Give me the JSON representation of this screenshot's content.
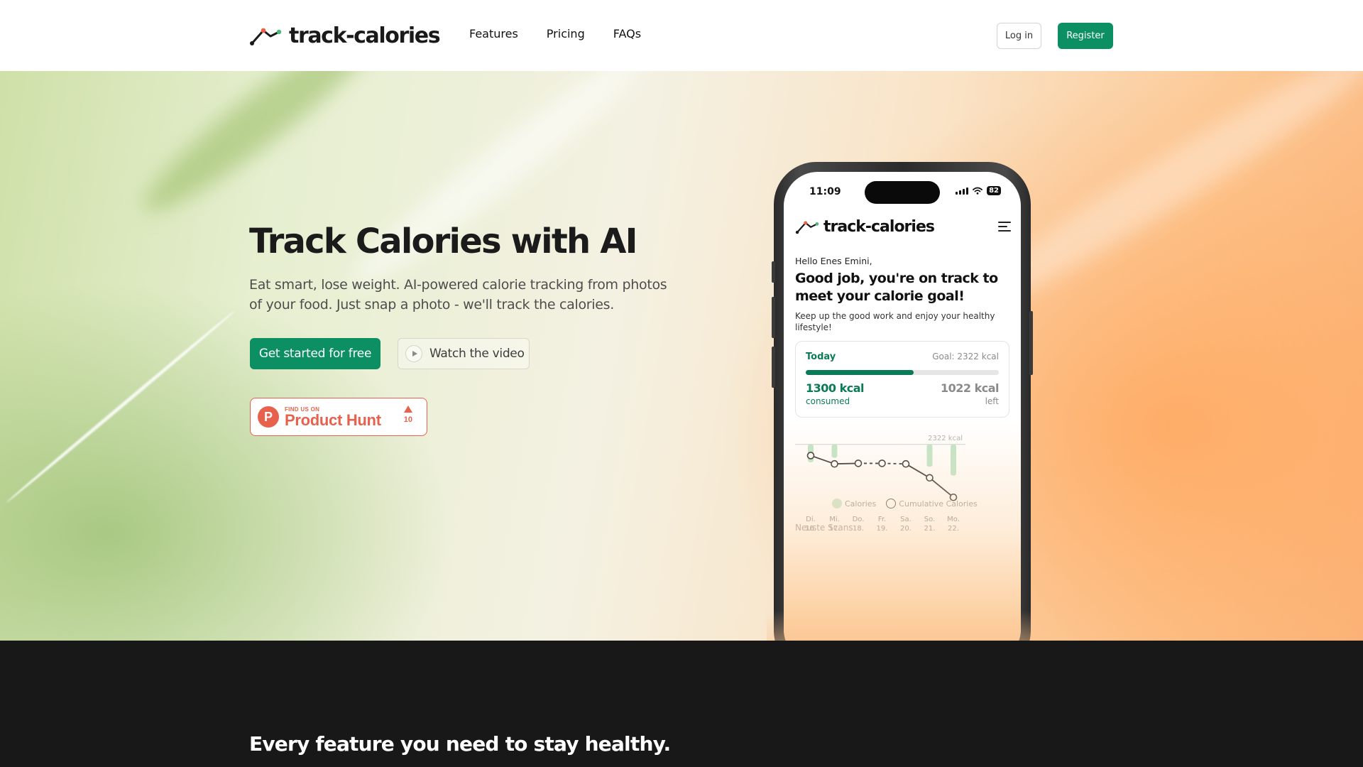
{
  "brand": {
    "name": "track-calories"
  },
  "nav": {
    "features": "Features",
    "pricing": "Pricing",
    "faqs": "FAQs"
  },
  "auth": {
    "login": "Log in",
    "register": "Register"
  },
  "hero": {
    "title": "Track Calories with AI",
    "subtitle": "Eat smart, lose weight. AI-powered calorie tracking from photos of your food. Just snap a photo - we'll track the calories.",
    "cta_primary": "Get started for free",
    "cta_video": "Watch the video"
  },
  "product_hunt": {
    "small": "FIND US ON",
    "name": "Product Hunt",
    "count": "10"
  },
  "phone": {
    "time": "11:09",
    "battery": "82",
    "app_name": "track-calories",
    "greeting": "Hello Enes Emini,",
    "headline": "Good job, you're on track to meet your calorie goal!",
    "subline": "Keep up the good work and enjoy your healthy lifestyle!",
    "today": {
      "label": "Today",
      "goal": "Goal: 2322 kcal",
      "consumed_value": "1300 kcal",
      "consumed_label": "consumed",
      "left_value": "1022 kcal",
      "left_label": "left",
      "progress_fraction": 0.56
    },
    "legend_calories": "Calories",
    "legend_cumulative": "Cumulative Calories",
    "recent_scans": "Neuste Scans"
  },
  "colors": {
    "primary": "#0b8f63",
    "product_hunt": "#e8614d",
    "dark_bg": "#181818"
  },
  "chart_data": {
    "type": "line",
    "goal_label": "2322 kcal",
    "goal": 2322,
    "categories": [
      {
        "day": "Di.",
        "date": "16."
      },
      {
        "day": "Mi.",
        "date": "17."
      },
      {
        "day": "Do.",
        "date": "18."
      },
      {
        "day": "Fr.",
        "date": "19."
      },
      {
        "day": "Sa.",
        "date": "20."
      },
      {
        "day": "So.",
        "date": "21."
      },
      {
        "day": "Mo.",
        "date": "22."
      }
    ],
    "bars": [
      400,
      300,
      0,
      0,
      0,
      500,
      700
    ],
    "line": [
      -400,
      -700,
      -680,
      -680,
      -700,
      -1200,
      -1900
    ],
    "line_dashed_segments": [
      2,
      3
    ],
    "ylim": [
      -2200,
      300
    ]
  },
  "features": {
    "title": "Every feature you need to stay healthy."
  }
}
